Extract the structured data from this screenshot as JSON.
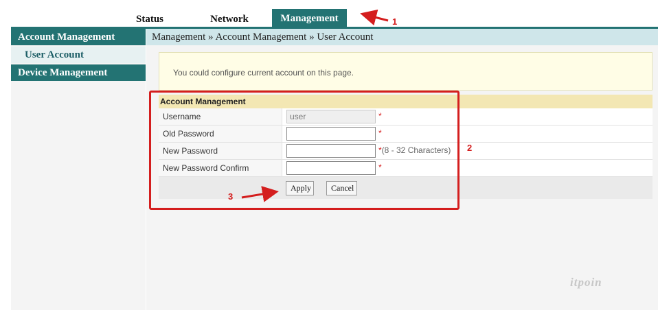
{
  "nav": {
    "tabs": [
      {
        "label": "Status"
      },
      {
        "label": "Network"
      },
      {
        "label": "Management",
        "active": true
      }
    ],
    "accent_color": "#237373"
  },
  "sidebar": {
    "sections": [
      {
        "label": "Account Management"
      },
      {
        "label": "User Account"
      },
      {
        "label": "Device Management"
      }
    ]
  },
  "breadcrumb": "Management » Account Management » User Account",
  "info_text": "You could configure current account on this page.",
  "form": {
    "title": "Account Management",
    "username_label": "Username",
    "username_value": "user",
    "old_password_label": "Old Password",
    "new_password_label": "New Password",
    "new_password_hint": "(8 - 32 Characters)",
    "confirm_label": "New Password Confirm",
    "required_mark": "*",
    "apply_label": "Apply",
    "cancel_label": "Cancel"
  },
  "annotations": {
    "num1": "1",
    "num2": "2",
    "num3": "3",
    "color": "#d41e1e"
  },
  "watermark": "itpoin"
}
